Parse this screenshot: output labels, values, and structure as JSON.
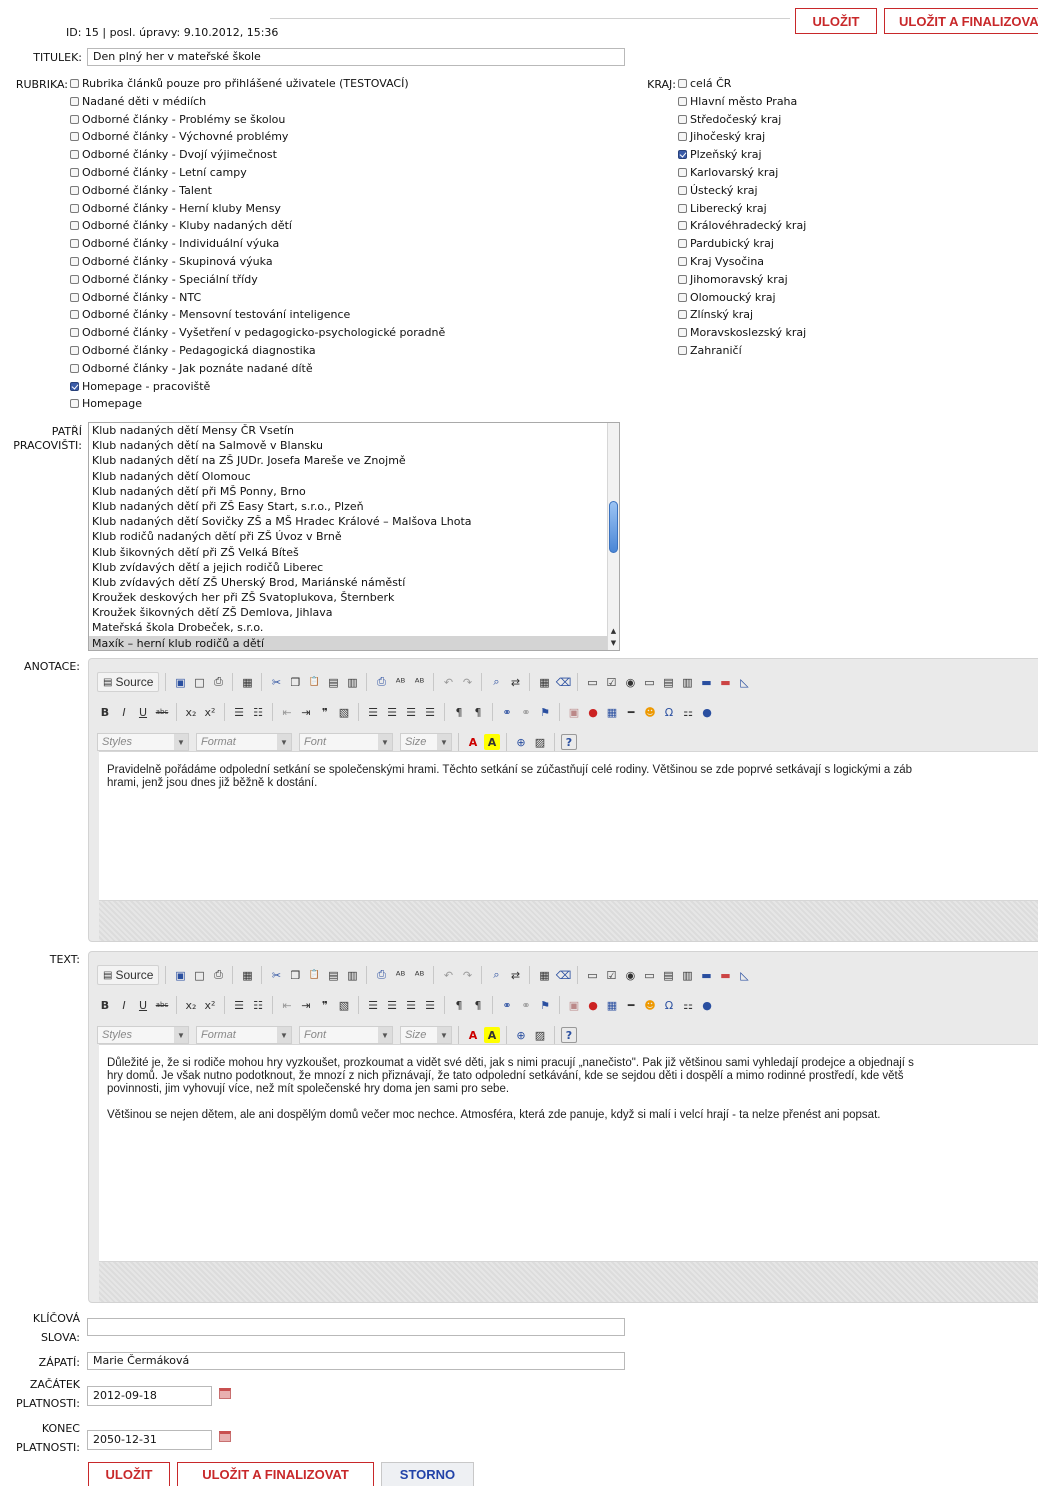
{
  "header": {
    "meta": "ID: 15 | posl. úpravy: 9.10.2012, 15:36",
    "save_label": "ULOŽIT",
    "save_final_label": "ULOŽIT A FINALIZOVAT"
  },
  "form": {
    "titulek_label": "TITULEK:",
    "titulek_value": "Den plný her v mateřské škole",
    "rubrika_label": "RUBRIKA:",
    "rubrika": [
      {
        "label": "Rubrika článků pouze pro přihlášené uživatele (TESTOVACÍ)",
        "checked": false
      },
      {
        "label": "Nadané děti v médiích",
        "checked": false
      },
      {
        "label": "Odborné články - Problémy se školou",
        "checked": false
      },
      {
        "label": "Odborné články - Výchovné problémy",
        "checked": false
      },
      {
        "label": "Odborné články - Dvojí výjimečnost",
        "checked": false
      },
      {
        "label": "Odborné články - Letní campy",
        "checked": false
      },
      {
        "label": "Odborné články - Talent",
        "checked": false
      },
      {
        "label": "Odborné články - Herní kluby Mensy",
        "checked": false
      },
      {
        "label": "Odborné články - Kluby nadaných dětí",
        "checked": false
      },
      {
        "label": "Odborné články - Individuální výuka",
        "checked": false
      },
      {
        "label": "Odborné články - Skupinová výuka",
        "checked": false
      },
      {
        "label": "Odborné články - Speciální třídy",
        "checked": false
      },
      {
        "label": "Odborné články - NTC",
        "checked": false
      },
      {
        "label": "Odborné články - Mensovní testování inteligence",
        "checked": false
      },
      {
        "label": "Odborné články - Vyšetření v pedagogicko-psychologické poradně",
        "checked": false
      },
      {
        "label": "Odborné články - Pedagogická diagnostika",
        "checked": false
      },
      {
        "label": "Odborné články - Jak poznáte nadané dítě",
        "checked": false
      },
      {
        "label": "Homepage - pracoviště",
        "checked": true
      },
      {
        "label": "Homepage",
        "checked": false
      }
    ],
    "kraj_label": "KRAJ:",
    "kraj": [
      {
        "label": "celá ČR",
        "checked": false
      },
      {
        "label": "Hlavní město Praha",
        "checked": false
      },
      {
        "label": "Středočeský kraj",
        "checked": false
      },
      {
        "label": "Jihočeský kraj",
        "checked": false
      },
      {
        "label": "Plzeňský kraj",
        "checked": true
      },
      {
        "label": "Karlovarský kraj",
        "checked": false
      },
      {
        "label": "Ústecký kraj",
        "checked": false
      },
      {
        "label": "Liberecký kraj",
        "checked": false
      },
      {
        "label": "Královéhradecký kraj",
        "checked": false
      },
      {
        "label": "Pardubický kraj",
        "checked": false
      },
      {
        "label": "Kraj Vysočina",
        "checked": false
      },
      {
        "label": "Jihomoravský kraj",
        "checked": false
      },
      {
        "label": "Olomoucký kraj",
        "checked": false
      },
      {
        "label": "Zlínský kraj",
        "checked": false
      },
      {
        "label": "Moravskoslezský kraj",
        "checked": false
      },
      {
        "label": "Zahraničí",
        "checked": false
      }
    ],
    "pracoviste_label_1": "PATŘÍ",
    "pracoviste_label_2": "PRACOVIŠTI:",
    "pracoviste": [
      {
        "label": "Klub nadaných dětí Mensy ČR Vsetín",
        "selected": false
      },
      {
        "label": "Klub nadaných dětí na Salmově v Blansku",
        "selected": false
      },
      {
        "label": "Klub nadaných dětí na ZŠ JUDr. Josefa Mareše ve Znojmě",
        "selected": false
      },
      {
        "label": "Klub nadaných dětí Olomouc",
        "selected": false
      },
      {
        "label": "Klub nadaných dětí při MŠ Ponny, Brno",
        "selected": false
      },
      {
        "label": "Klub nadaných dětí při ZŠ Easy Start, s.r.o., Plzeň",
        "selected": false
      },
      {
        "label": "Klub nadaných dětí Sovičky ZŠ a MŠ Hradec Králové – Malšova Lhota",
        "selected": false
      },
      {
        "label": "Klub rodičů nadaných dětí při ZŠ Úvoz v Brně",
        "selected": false
      },
      {
        "label": "Klub šikovných dětí při ZŠ Velká Bíteš",
        "selected": false
      },
      {
        "label": "Klub zvídavých dětí a jejich rodičů Liberec",
        "selected": false
      },
      {
        "label": "Klub zvídavých dětí ZŠ Uherský Brod, Mariánské náměstí",
        "selected": false
      },
      {
        "label": "Kroužek deskových her při ZŠ Svatoplukova, Šternberk",
        "selected": false
      },
      {
        "label": "Kroužek šikovných dětí ZŠ Demlova, Jihlava",
        "selected": false
      },
      {
        "label": "Mateřská škola Drobeček, s.r.o.",
        "selected": false
      },
      {
        "label": "Maxík – herní klub rodičů a dětí",
        "selected": true
      }
    ],
    "anotace_label": "ANOTACE:",
    "text_label": "TEXT:",
    "klicova_label_1": "KLÍČOVÁ",
    "klicova_label_2": "SLOVA:",
    "klicova_value": "",
    "zapati_label": "ZÁPATÍ:",
    "zapati_value": "Marie Čermáková",
    "zacatek_label_1": "ZAČÁTEK",
    "zacatek_label_2": "PLATNOSTI:",
    "zacatek_value": "2012-09-18",
    "konec_label_1": "KONEC",
    "konec_label_2": "PLATNOSTI:",
    "konec_value": "2050-12-31"
  },
  "editor": {
    "source_label": "Source",
    "styles_placeholder": "Styles",
    "format_placeholder": "Format",
    "font_placeholder": "Font",
    "size_placeholder": "Size"
  },
  "anotace_text": "Pravidelně pořádáme odpolední setkání se společenskými hrami. Těchto setkání se zúčastňují celé rodiny. Většinou se zde poprvé setkávají s logickými a záb\nhrami, jenž jsou dnes již běžně k dostání.",
  "text_paragraphs": [
    "Důležité je, že si rodiče mohou hry vyzkoušet, prozkoumat a vidět své děti, jak s nimi pracují „nanečisto\". Pak již většinou sami vyhledají prodejce a objednají s\nhry domů. Je však nutno podotknout, že mnozí z nich přiznávají, že tato odpolední setkávání, kde se sejdou děti i dospělí a mimo rodinné prostředí, kde větš\npovinnosti, jim vyhovují více, než mít společenské hry doma jen sami pro sebe.",
    "Většinou se nejen dětem, ale ani dospělým domů večer moc nechce. Atmosféra, která zde panuje, když si malí i velcí hrají - ta nelze přenést ani popsat."
  ],
  "footer": {
    "save_label": "ULOŽIT",
    "save_final_label": "ULOŽIT A FINALIZOVAT",
    "cancel_label": "STORNO"
  },
  "colors": {
    "accent_red": "#c8282a",
    "link_blue": "#2243a8",
    "checked_blue": "#3b5ca8"
  }
}
